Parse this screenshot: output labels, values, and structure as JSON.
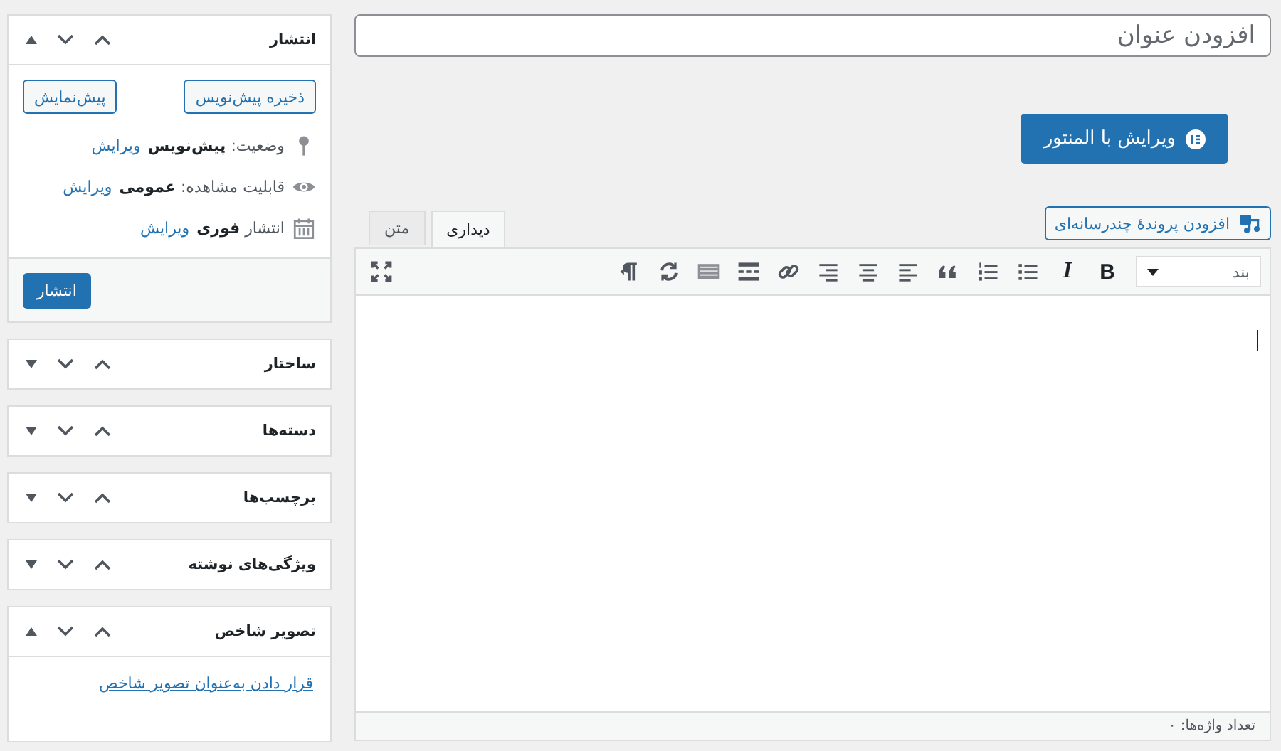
{
  "title_field": {
    "placeholder": "افزودن عنوان"
  },
  "elementor_button": {
    "label": "ویرایش با المنتور"
  },
  "media_button": {
    "label": "افزودن پروندهٔ چندرسانه‌ای"
  },
  "editor_tabs": [
    {
      "label": "دیداری",
      "selected": true
    },
    {
      "label": "متن",
      "selected": false
    }
  ],
  "toolbar": {
    "format_select": {
      "value": "بند"
    },
    "buttons": [
      {
        "kind": "bold",
        "label": "B"
      },
      {
        "kind": "italic",
        "label": "I"
      },
      {
        "kind": "bullet-list"
      },
      {
        "kind": "numbered-list"
      },
      {
        "kind": "quote"
      },
      {
        "kind": "align-left"
      },
      {
        "kind": "align-center"
      },
      {
        "kind": "align-right"
      },
      {
        "kind": "link"
      },
      {
        "kind": "read-more"
      },
      {
        "kind": "toolbar-toggle"
      },
      {
        "kind": "refresh"
      },
      {
        "kind": "paragraph-direction"
      },
      {
        "kind": "fullscreen"
      }
    ]
  },
  "word_count": "تعداد واژه‌ها: ۰",
  "sidebar": [
    {
      "kind": "publish",
      "title": "انتشار",
      "expanded": true,
      "buttons": [
        "ذخیره پیش‌نویس",
        "پیش‌نمایش"
      ],
      "rows": [
        {
          "kind": "status",
          "text": "وضعیت: **پیش‌نویس**",
          "link": "ویرایش"
        },
        {
          "kind": "visibility",
          "text": "قابلیت مشاهده: **عمومی**",
          "link": "ویرایش"
        },
        {
          "kind": "schedule",
          "text": "انتشار **فوری**",
          "link": "ویرایش"
        }
      ],
      "publish_button": "انتشار"
    },
    {
      "kind": "plain",
      "title": "ساختار",
      "expanded": false
    },
    {
      "kind": "plain",
      "title": "دسته‌ها",
      "expanded": false
    },
    {
      "kind": "plain",
      "title": "برچسب‌ها",
      "expanded": false
    },
    {
      "kind": "plain",
      "title": "ویژگی‌های نوشته",
      "expanded": false
    },
    {
      "kind": "featured-image",
      "title": "تصویر شاخص",
      "expanded": true,
      "link": "قرار دادن به‌عنوان تصویر شاخص"
    }
  ]
}
